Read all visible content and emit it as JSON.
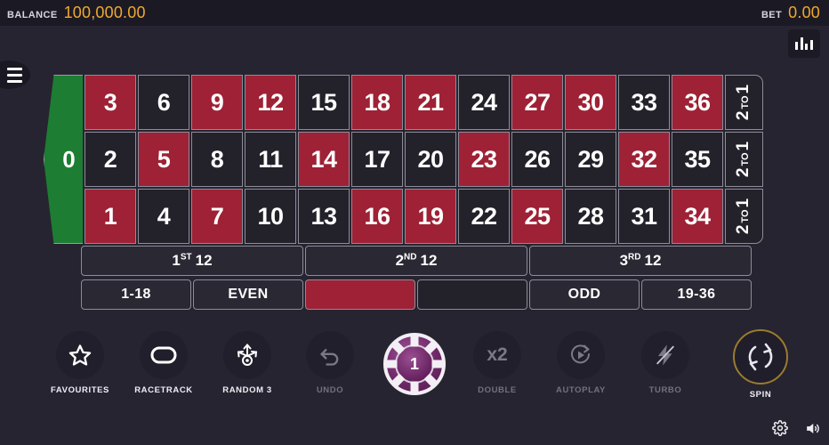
{
  "header": {
    "balance_label": "BALANCE",
    "balance_value": "100,000.00",
    "bet_label": "BET",
    "bet_value": "0.00",
    "accent_color": "#f0a830",
    "stats_icon": "bar-chart-icon",
    "menu_icon": "hamburger-menu-icon"
  },
  "table": {
    "zero": "0",
    "zero_color": "#1d7d32",
    "red_color": "#9e2135",
    "black_color": "#232129",
    "rows": [
      [
        {
          "n": "3",
          "c": "red"
        },
        {
          "n": "6",
          "c": "black"
        },
        {
          "n": "9",
          "c": "red"
        },
        {
          "n": "12",
          "c": "red"
        },
        {
          "n": "15",
          "c": "black"
        },
        {
          "n": "18",
          "c": "red"
        },
        {
          "n": "21",
          "c": "red"
        },
        {
          "n": "24",
          "c": "black"
        },
        {
          "n": "27",
          "c": "red"
        },
        {
          "n": "30",
          "c": "red"
        },
        {
          "n": "33",
          "c": "black"
        },
        {
          "n": "36",
          "c": "red"
        }
      ],
      [
        {
          "n": "2",
          "c": "black"
        },
        {
          "n": "5",
          "c": "red"
        },
        {
          "n": "8",
          "c": "black"
        },
        {
          "n": "11",
          "c": "black"
        },
        {
          "n": "14",
          "c": "red"
        },
        {
          "n": "17",
          "c": "black"
        },
        {
          "n": "20",
          "c": "black"
        },
        {
          "n": "23",
          "c": "red"
        },
        {
          "n": "26",
          "c": "black"
        },
        {
          "n": "29",
          "c": "black"
        },
        {
          "n": "32",
          "c": "red"
        },
        {
          "n": "35",
          "c": "black"
        }
      ],
      [
        {
          "n": "1",
          "c": "red"
        },
        {
          "n": "4",
          "c": "black"
        },
        {
          "n": "7",
          "c": "red"
        },
        {
          "n": "10",
          "c": "black"
        },
        {
          "n": "13",
          "c": "black"
        },
        {
          "n": "16",
          "c": "red"
        },
        {
          "n": "19",
          "c": "red"
        },
        {
          "n": "22",
          "c": "black"
        },
        {
          "n": "25",
          "c": "red"
        },
        {
          "n": "28",
          "c": "black"
        },
        {
          "n": "31",
          "c": "black"
        },
        {
          "n": "34",
          "c": "red"
        }
      ]
    ],
    "column_bets": [
      {
        "big": "2",
        "small": "TO",
        "big2": "1",
        "full": "2 TO 1"
      },
      {
        "big": "2",
        "small": "TO",
        "big2": "1",
        "full": "2 TO 1"
      },
      {
        "big": "2",
        "small": "TO",
        "big2": "1",
        "full": "2 TO 1"
      }
    ],
    "dozens": [
      {
        "num": "1",
        "ord": "ST",
        "count": "12"
      },
      {
        "num": "2",
        "ord": "ND",
        "count": "12"
      },
      {
        "num": "3",
        "ord": "RD",
        "count": "12"
      }
    ],
    "outside": [
      {
        "label": "1-18",
        "kind": "text"
      },
      {
        "label": "EVEN",
        "kind": "text"
      },
      {
        "label": "",
        "kind": "red"
      },
      {
        "label": "",
        "kind": "black"
      },
      {
        "label": "ODD",
        "kind": "text"
      },
      {
        "label": "19-36",
        "kind": "text"
      }
    ]
  },
  "toolbar": {
    "favourites": {
      "label": "FAVOURITES",
      "icon": "star-icon",
      "enabled": true
    },
    "racetrack": {
      "label": "RACETRACK",
      "icon": "oval-track-icon",
      "enabled": true
    },
    "random3": {
      "label": "RANDOM 3",
      "icon": "random-arrows-icon",
      "enabled": true
    },
    "undo": {
      "label": "UNDO",
      "icon": "undo-arrow-icon",
      "enabled": false
    },
    "chip": {
      "value": "1",
      "name": "chip-denomination",
      "color": "#6f2968"
    },
    "double": {
      "label": "DOUBLE",
      "icon": "x2-icon",
      "enabled": false
    },
    "autoplay": {
      "label": "AUTOPLAY",
      "icon": "autoplay-icon",
      "enabled": false
    },
    "turbo": {
      "label": "TURBO",
      "icon": "turbo-off-icon",
      "enabled": false
    },
    "spin": {
      "label": "SPIN",
      "icon": "spin-arrows-icon",
      "enabled": true,
      "ring_color": "#9a7b2e"
    }
  },
  "footer": {
    "settings_icon": "gear-icon",
    "sound_icon": "speaker-icon"
  }
}
